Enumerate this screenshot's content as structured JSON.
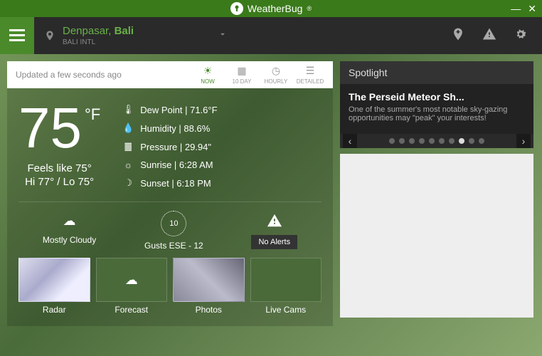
{
  "brand": {
    "name": "WeatherBug",
    "reg": "®"
  },
  "navbar": {
    "location": {
      "city": "Denpasar,",
      "region": "Bali",
      "station": "BALI INTL"
    }
  },
  "updateBar": {
    "text": "Updated a few seconds ago"
  },
  "tabs": {
    "now": "NOW",
    "tenday": "10 DAY",
    "hourly": "HOURLY",
    "detailed": "DETAILED"
  },
  "weather": {
    "temp": "75",
    "unit": "°F",
    "feels": "Feels like 75°",
    "hilo": "Hi 77° / Lo 75°",
    "details": {
      "dew": "Dew Point  |  71.6°F",
      "humidity": "Humidity  |  88.6%",
      "pressure": "Pressure  |  29.94\"",
      "sunrise": "Sunrise  |  6:28 AM",
      "sunset": "Sunset  |  6:18 PM"
    },
    "condition": "Mostly Cloudy",
    "wind": {
      "speed": "10",
      "label": "Gusts ESE - 12"
    },
    "alerts": "No Alerts"
  },
  "thumbs": {
    "radar": "Radar",
    "forecast": "Forecast",
    "photos": "Photos",
    "livecams": "Live Cams"
  },
  "spotlight": {
    "header": "Spotlight",
    "title": "The Perseid Meteor Sh...",
    "desc": "One of the summer's most notable sky-gazing opportunities may \"peak\" your interests!",
    "dotCount": 10,
    "activeDot": 8
  }
}
